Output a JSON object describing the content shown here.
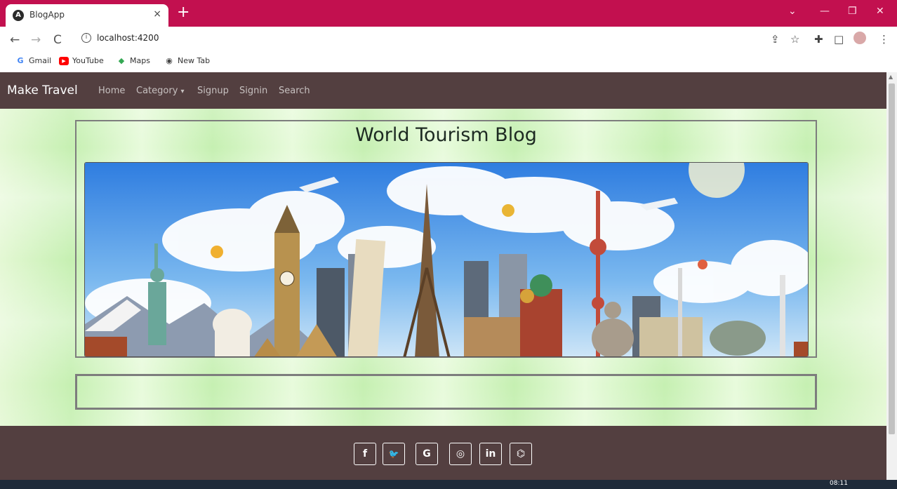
{
  "browser": {
    "tab_title": "BlogApp",
    "tab_favicon": "A",
    "tab_close": "×",
    "new_tab": "+",
    "url": "localhost:4200",
    "bookmarks": [
      {
        "label": "Gmail",
        "icon": "gmail-icon",
        "glyph": "G",
        "color": "#4285f4"
      },
      {
        "label": "YouTube",
        "icon": "youtube-icon",
        "glyph": "▶",
        "color": "#ff0000"
      },
      {
        "label": "Maps",
        "icon": "maps-icon",
        "glyph": "◆",
        "color": "#34a853"
      },
      {
        "label": "New Tab",
        "icon": "globe-icon",
        "glyph": "◉",
        "color": "#444"
      }
    ]
  },
  "navbar": {
    "brand": "Make Travel",
    "links": [
      "Home",
      "Category",
      "Signup",
      "Signin",
      "Search"
    ],
    "category_caret": "▾"
  },
  "main": {
    "blog_title": "World Tourism Blog"
  },
  "footer": {
    "social": [
      {
        "name": "facebook-icon",
        "glyph": "f"
      },
      {
        "name": "twitter-icon",
        "glyph": "🐦"
      },
      {
        "name": "google-icon",
        "glyph": "G"
      },
      {
        "name": "instagram-icon",
        "glyph": "◎"
      },
      {
        "name": "linkedin-icon",
        "glyph": "in"
      },
      {
        "name": "github-icon",
        "glyph": "⌬"
      }
    ]
  },
  "taskbar": {
    "time": "08:11"
  },
  "colors": {
    "tabstrip": "#c2104f",
    "navbar": "#533f40",
    "page_green": "#c6f0b2"
  }
}
